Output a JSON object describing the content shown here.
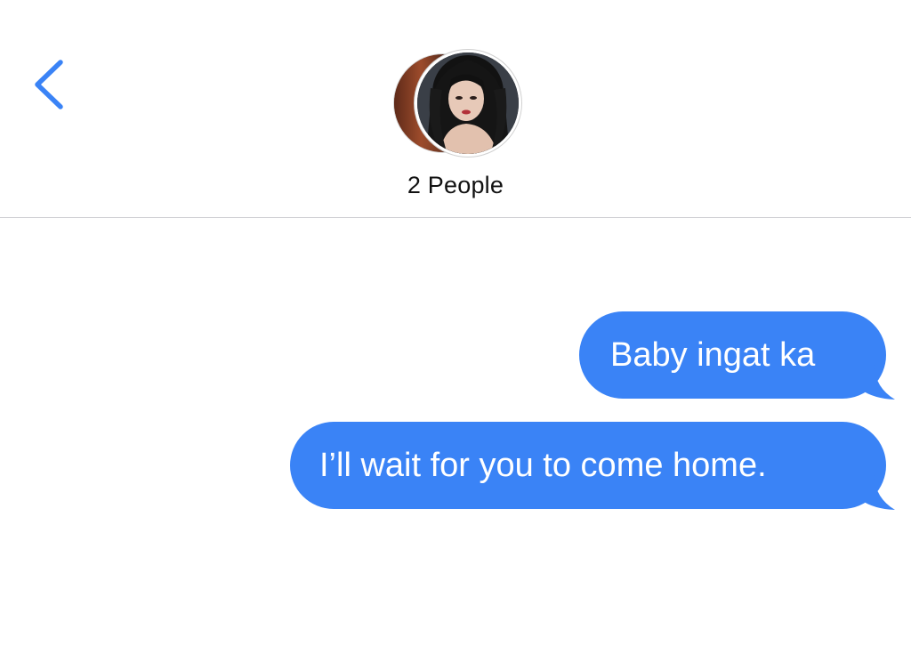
{
  "header": {
    "back_icon": "chevron-left-icon",
    "group_title": "2 People",
    "avatars": [
      "contact-avatar-1",
      "contact-avatar-2"
    ]
  },
  "messages": [
    {
      "text": "Baby ingat ka",
      "direction": "outgoing"
    },
    {
      "text": "I’ll wait for you to come home.",
      "direction": "outgoing"
    }
  ],
  "colors": {
    "accent": "#3a83f6",
    "bubble_text": "#ffffff",
    "title_text": "#111111",
    "divider": "#cfcfd3",
    "background": "#ffffff"
  }
}
